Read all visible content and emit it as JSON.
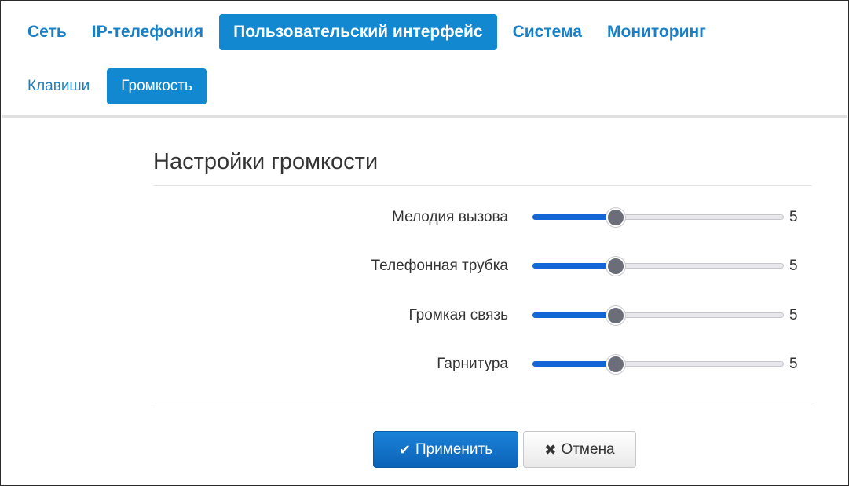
{
  "top_nav": {
    "tabs": [
      {
        "label": "Сеть"
      },
      {
        "label": "IP-телефония"
      },
      {
        "label": "Пользовательский интерфейс"
      },
      {
        "label": "Система"
      },
      {
        "label": "Мониторинг"
      }
    ],
    "active_index": 2
  },
  "sub_nav": {
    "tabs": [
      {
        "label": "Клавиши"
      },
      {
        "label": "Громкость"
      }
    ],
    "active_index": 1
  },
  "panel": {
    "title": "Настройки громкости"
  },
  "sliders": [
    {
      "label": "Мелодия вызова",
      "value": "5",
      "fraction": 0.33
    },
    {
      "label": "Телефонная трубка",
      "value": "5",
      "fraction": 0.33
    },
    {
      "label": "Громкая связь",
      "value": "5",
      "fraction": 0.33
    },
    {
      "label": "Гарнитура",
      "value": "5",
      "fraction": 0.33
    }
  ],
  "buttons": {
    "apply_label": "Применить",
    "apply_icon": "checkmark-icon",
    "cancel_label": "Отмена",
    "cancel_icon": "close-icon"
  },
  "colors": {
    "accent": "#1188cf",
    "slider_fill": "#1466d6",
    "slider_thumb": "#6b6e78",
    "primary_button": "#0e6fc7"
  }
}
